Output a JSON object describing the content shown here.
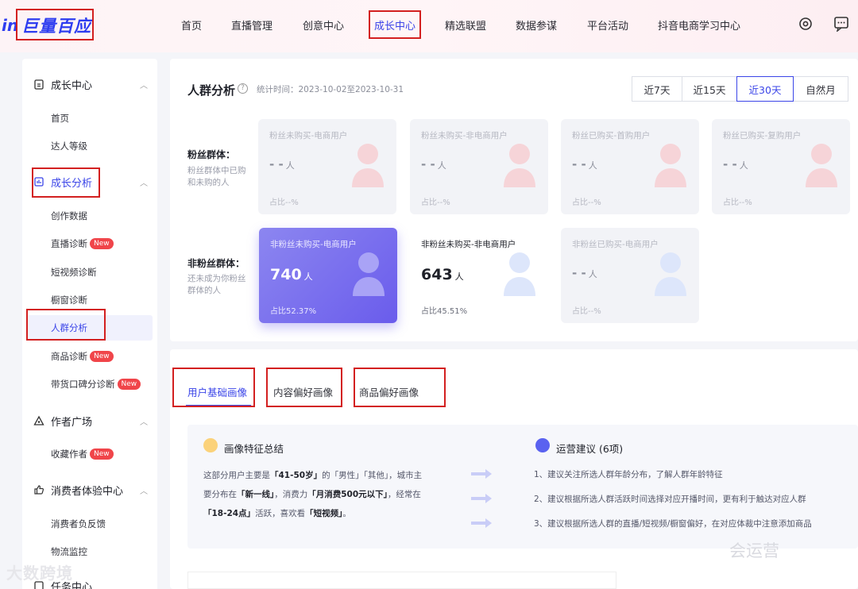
{
  "header": {
    "logo_prefix": "in",
    "logo_name": "巨量百应",
    "nav": [
      "首页",
      "直播管理",
      "创意中心",
      "成长中心",
      "精选联盟",
      "数据参谋",
      "平台活动",
      "抖音电商学习中心"
    ]
  },
  "sidebar": {
    "groups": [
      {
        "label": "成长中心",
        "icon": "clipboard-icon"
      },
      {
        "label": "成长分析",
        "icon": "chart-box-icon"
      },
      {
        "label": "作者广场",
        "icon": "triangle-people-icon"
      },
      {
        "label": "消费者体验中心",
        "icon": "thumb-icon"
      },
      {
        "label": "任务中心",
        "icon": "task-icon"
      }
    ],
    "items": [
      "首页",
      "达人等级",
      "创作数据",
      "直播诊断",
      "短视频诊断",
      "橱窗诊断",
      "人群分析",
      "商品诊断",
      "带货口碑分诊断",
      "收藏作者",
      "消费者负反馈",
      "物流监控"
    ],
    "new_badge": "New"
  },
  "analysis": {
    "title": "人群分析",
    "help": "?",
    "period": "统计时间：2023-10-02至2023-10-31",
    "ranges": [
      "近7天",
      "近15天",
      "近30天",
      "自然月"
    ],
    "fans": {
      "label": "粉丝群体：",
      "desc": "粉丝群体中已购和未购的人",
      "cards": [
        {
          "title": "粉丝未购买-电商用户",
          "value": "- -",
          "unit": "人",
          "ratio": "占比--%"
        },
        {
          "title": "粉丝未购买-非电商用户",
          "value": "- -",
          "unit": "人",
          "ratio": "占比--%"
        },
        {
          "title": "粉丝已购买-首购用户",
          "value": "- -",
          "unit": "人",
          "ratio": "占比--%"
        },
        {
          "title": "粉丝已购买-复购用户",
          "value": "- -",
          "unit": "人",
          "ratio": "占比--%"
        }
      ]
    },
    "nonfans": {
      "label": "非粉丝群体：",
      "desc": "还未成为你粉丝群体的人",
      "cards": [
        {
          "title": "非粉丝未购买-电商用户",
          "value": "740",
          "unit": "人",
          "ratio": "占比52.37%"
        },
        {
          "title": "非粉丝未购买-非电商用户",
          "value": "643",
          "unit": "人",
          "ratio": "占比45.51%"
        },
        {
          "title": "非粉丝已购买-电商用户",
          "value": "- -",
          "unit": "人",
          "ratio": "占比--%"
        }
      ]
    }
  },
  "portrait": {
    "tabs": [
      "用户基础画像",
      "内容偏好画像",
      "商品偏好画像"
    ],
    "summary_title": "画像特征总结",
    "summary": {
      "p1": "这部分用户主要是",
      "age": "「41-50岁」",
      "p2": "的「男性」「其他」，城市主要分布在",
      "city": "「新一线」",
      "p3": "，消费力",
      "spend": "「月消费500元以下」",
      "p4": "，经常在",
      "time": "「18-24点」",
      "p5": "活跃，喜欢看",
      "likes": "「短视频」",
      "p6": "。"
    },
    "advice_title": "运营建议 (6项)",
    "advice": [
      "1、建议关注所选人群年龄分布，了解人群年龄特征",
      "2、建议根据所选人群活跃时间选择对应开播时间，更有利于触达对应人群",
      "3、建议根据所选人群的直播/短视频/橱窗偏好，在对应体裁中注意添加商品"
    ]
  },
  "watermarks": [
    "大数跨境",
    "会运营"
  ]
}
